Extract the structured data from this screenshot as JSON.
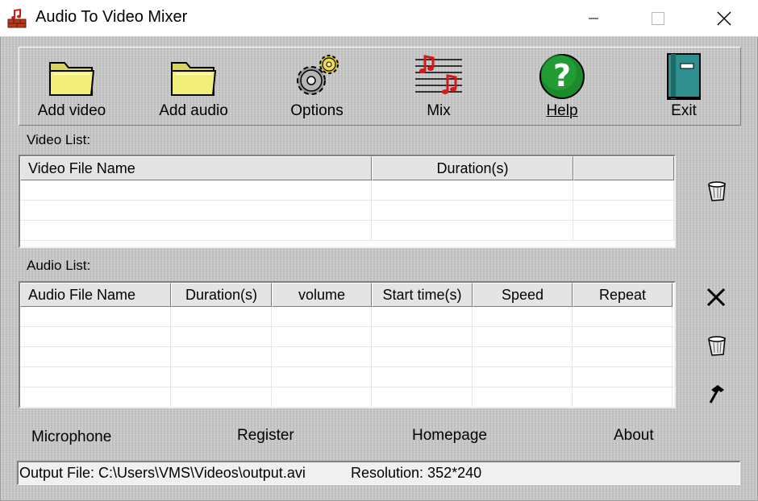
{
  "window": {
    "title": "Audio To Video Mixer"
  },
  "toolbar": {
    "items": [
      {
        "label": "Add video",
        "icon": "folder-icon"
      },
      {
        "label": "Add audio",
        "icon": "folder-icon"
      },
      {
        "label": "Options",
        "icon": "gears-icon"
      },
      {
        "label": "Mix",
        "icon": "music-notes-icon"
      },
      {
        "label": "Help",
        "icon": "help-question-icon"
      },
      {
        "label": "Exit",
        "icon": "exit-book-icon"
      }
    ]
  },
  "video_list": {
    "label": "Video List:",
    "columns": [
      "Video File Name",
      "Duration(s)",
      ""
    ],
    "rows": []
  },
  "audio_list": {
    "label": "Audio List:",
    "columns": [
      "Audio File Name",
      "Duration(s)",
      "volume",
      "Start time(s)",
      "Speed",
      "Repeat"
    ],
    "rows": []
  },
  "side_buttons": {
    "video_remove": "trash-icon",
    "audio_delete": "close-x-icon",
    "audio_remove": "trash-icon",
    "audio_edit": "hammer-icon"
  },
  "links": {
    "microphone": "Microphone",
    "register": "Register",
    "homepage": "Homepage",
    "about": "About"
  },
  "status": {
    "output_file": "Output File: C:\\Users\\VMS\\Videos\\output.avi",
    "resolution": "Resolution: 352*240"
  },
  "colors": {
    "window_bg": "#c9c9c9",
    "list_bg": "#ffffff",
    "help_green": "#1a8a2a",
    "mix_red": "#d81818",
    "exit_teal": "#2f8f8f",
    "folder_yellow": "#f2ee7a"
  }
}
